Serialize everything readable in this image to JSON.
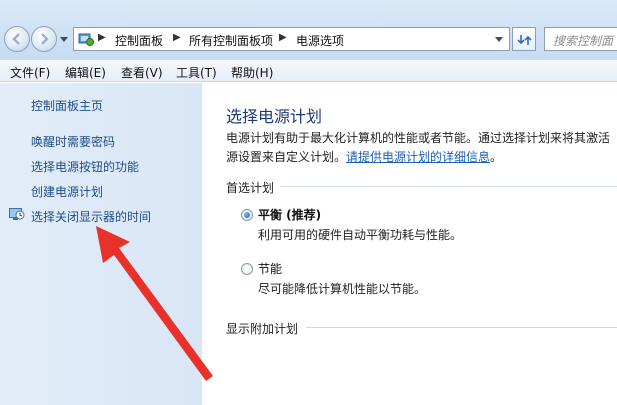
{
  "address_bar": {
    "breadcrumb": [
      "控制面板",
      "所有控制面板项",
      "电源选项"
    ],
    "search_placeholder": "搜索控制面"
  },
  "menu": [
    "文件(F)",
    "编辑(E)",
    "查看(V)",
    "工具(T)",
    "帮助(H)"
  ],
  "left_pane": {
    "links": [
      "控制面板主页",
      "唤醒时需要密码",
      "选择电源按钮的功能",
      "创建电源计划",
      "选择关闭显示器的时间"
    ]
  },
  "main": {
    "title": "选择电源计划",
    "description_line1": "电源计划有助于最大化计算机的性能或者节能。通过选择计划来将其激活",
    "description_line2": "源设置来自定义计划。",
    "description_link": "请提供电源计划的详细信息",
    "description_end": "。",
    "preferred_header": "首选计划",
    "plans": [
      {
        "name": "平衡 (推荐)",
        "desc": "利用可用的硬件自动平衡功耗与性能。",
        "selected": true
      },
      {
        "name": "节能",
        "desc": "尽可能降低计算机性能以节能。",
        "selected": false
      }
    ],
    "additional_header": "显示附加计划"
  },
  "colors": {
    "accent_link": "#1d4f8a",
    "title": "#1e3a78",
    "annotation_arrow": "#e8312b"
  }
}
